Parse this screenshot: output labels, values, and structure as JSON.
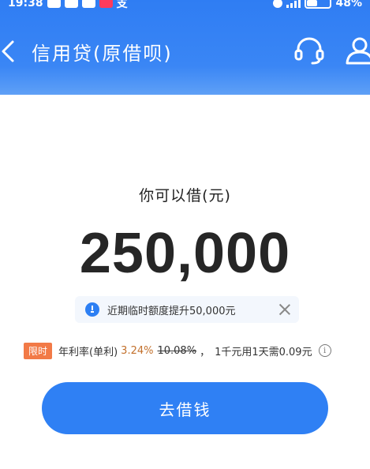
{
  "status_bar": {
    "time": "19:38",
    "extra_glyph": "支",
    "battery_percent": "48%",
    "battery_level": 0.48
  },
  "header": {
    "title": "信用贷(原借呗)",
    "back_icon": "chevron-left-icon",
    "service_icon": "headset-icon",
    "profile_icon": "user-icon"
  },
  "main": {
    "amount_label": "你可以借(元)",
    "amount": "250,000",
    "notice": {
      "text": "近期临时额度提升50,000元",
      "icon": "info-circle-icon"
    },
    "rate": {
      "tag": "限时",
      "label": "年利率(单利)",
      "current": "3.24%",
      "original": "10.08%",
      "separator": "，",
      "daily_cost": "1千元用1天需0.09元",
      "info_icon": "i"
    },
    "borrow_button": "去借钱"
  },
  "colors": {
    "header_blue": "#2f7df3",
    "button_blue": "#2f80f4",
    "tag_orange": "#f27a47",
    "rate_orange": "#c2702c"
  }
}
